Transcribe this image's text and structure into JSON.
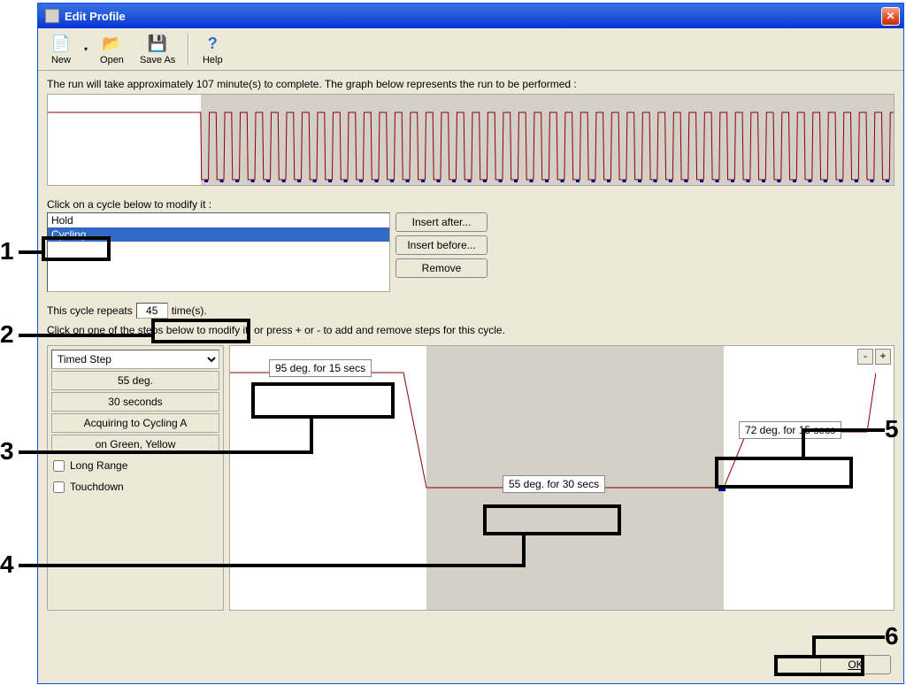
{
  "window": {
    "title": "Edit Profile"
  },
  "toolbar": {
    "new": "New",
    "open": "Open",
    "saveas": "Save As",
    "help": "Help"
  },
  "info_line": "The run will take approximately 107 minute(s) to complete. The graph below represents the run to be performed :",
  "cycle_label": "Click on a cycle below to modify it :",
  "cycles": {
    "item0": "Hold",
    "item1": "Cycling"
  },
  "cycle_buttons": {
    "insert_after": "Insert after...",
    "insert_before": "Insert before...",
    "remove": "Remove"
  },
  "repeat": {
    "prefix": "This cycle repeats",
    "value": "45",
    "suffix": "time(s)."
  },
  "steps_label": "Click on one of the steps below to modify it, or press + or - to add and remove steps for this cycle.",
  "step_type": "Timed Step",
  "step_info": {
    "temp": "55 deg.",
    "duration": "30 seconds",
    "acq": "Acquiring to Cycling A",
    "channels": "on Green, Yellow"
  },
  "checks": {
    "longrange": "Long Range",
    "touchdown": "Touchdown"
  },
  "annots": {
    "a1": "95 deg. for 15 secs",
    "a2": "55 deg. for 30 secs",
    "a3": "72 deg. for 15 secs"
  },
  "pm": {
    "minus": "-",
    "plus": "+"
  },
  "ok": "OK",
  "callouts": {
    "n1": "1",
    "n2": "2",
    "n3": "3",
    "n4": "4",
    "n5": "5",
    "n6": "6"
  },
  "chart_data": {
    "overview_graph": {
      "type": "line",
      "description": "PCR thermal profile: initial hold segment followed by 45 repeated cycling segments",
      "hold_fraction": 0.18,
      "cycles": 45
    },
    "step_profile": {
      "type": "line",
      "steps": [
        {
          "temperature_deg": 95,
          "duration_sec": 15
        },
        {
          "temperature_deg": 55,
          "duration_sec": 30
        },
        {
          "temperature_deg": 72,
          "duration_sec": 15
        }
      ]
    }
  }
}
